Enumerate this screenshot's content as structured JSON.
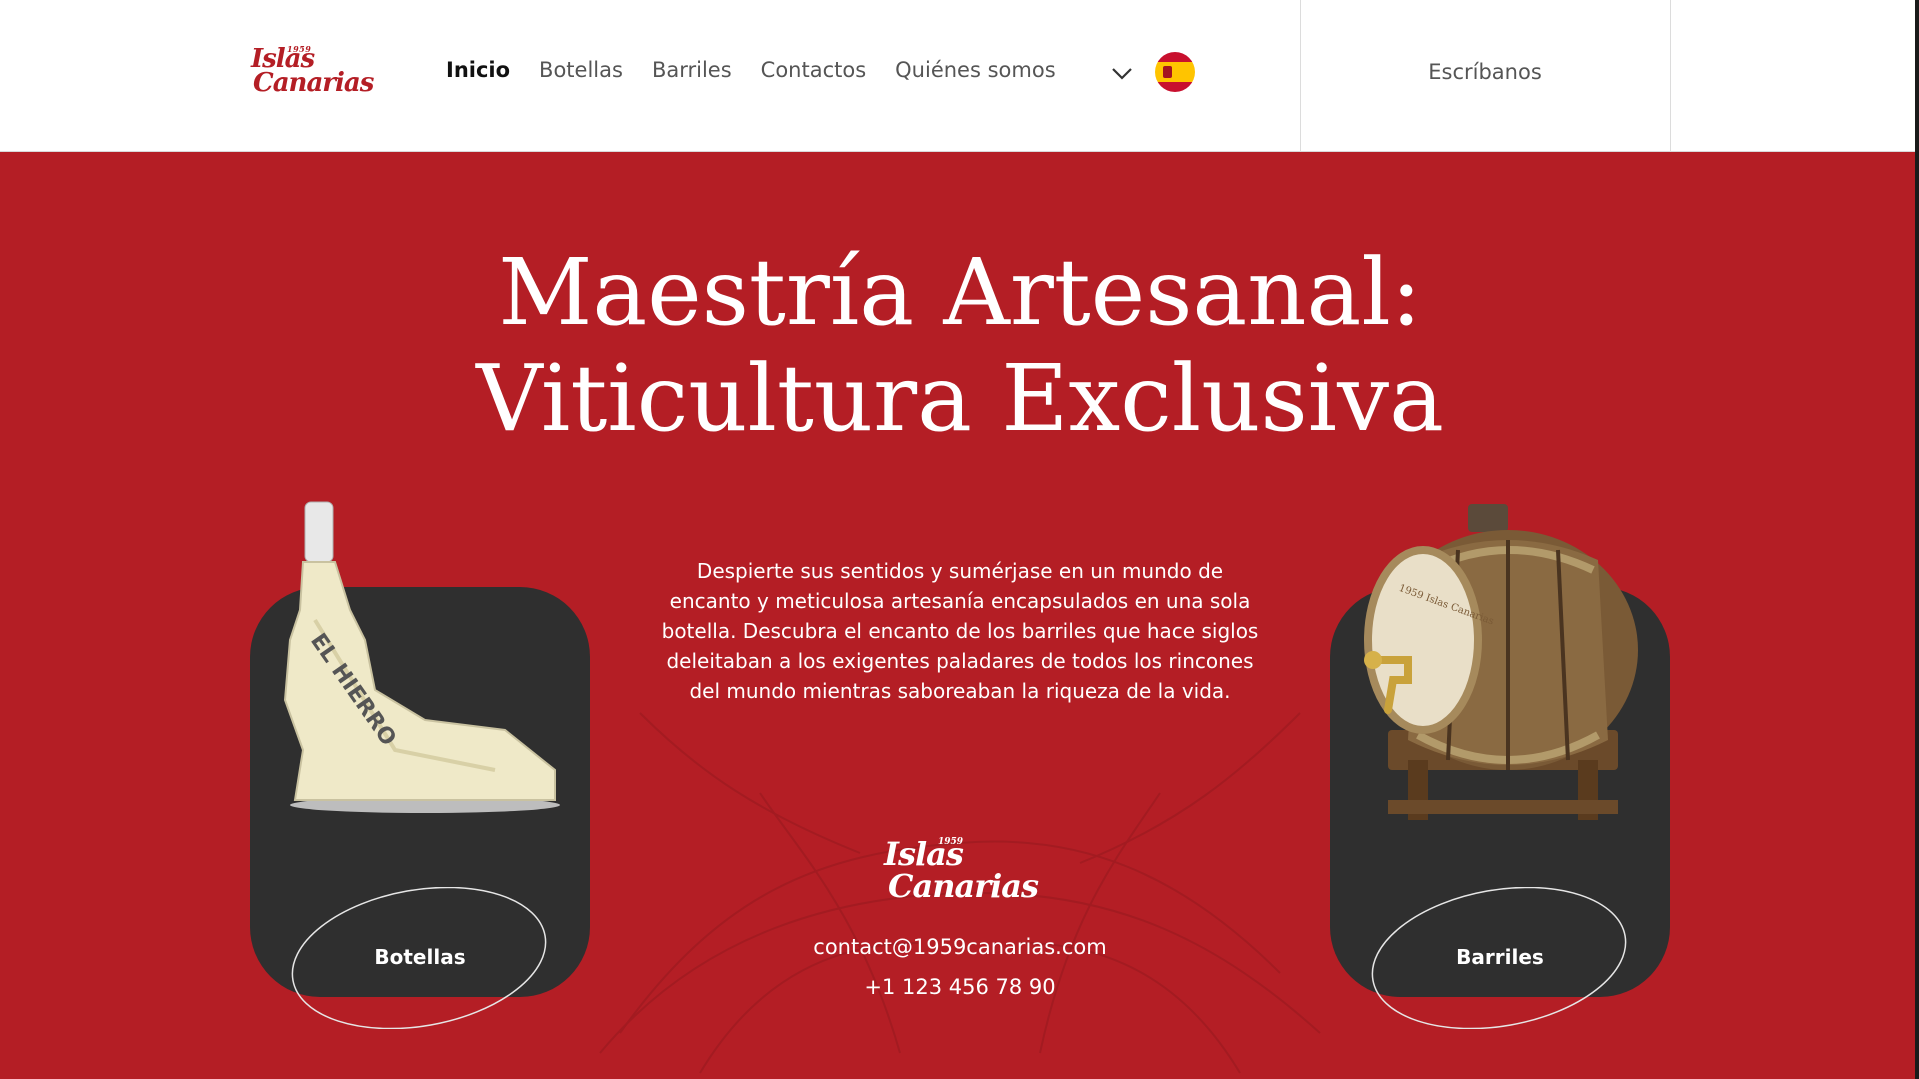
{
  "brand": {
    "year": "1959",
    "line1": "Islas",
    "line2": "Canarias"
  },
  "nav": {
    "items": [
      {
        "label": "Inicio",
        "active": true
      },
      {
        "label": "Botellas",
        "active": false
      },
      {
        "label": "Barriles",
        "active": false
      },
      {
        "label": "Contactos",
        "active": false
      },
      {
        "label": "Quiénes somos",
        "active": false
      }
    ],
    "write_label": "Escríbanos",
    "language_flag": "spain-flag-icon"
  },
  "hero": {
    "title_line1": "Maestría Artesanal:",
    "title_line2": "Viticultura Exclusiva",
    "description": "Despierte sus sentidos y sumérjase en un mundo de encanto y meticulosa artesanía encapsulados en una sola botella. Descubra el encanto de los barriles que hace siglos deleitaban a los exigentes paladares de todos los rincones del mundo mientras saboreaban la riqueza de la vida.",
    "bottle_engraving": "EL HIERRO",
    "barrel_engraving": "1959 Islas Canarias"
  },
  "cards": {
    "left_label": "Botellas",
    "right_label": "Barriles"
  },
  "contact": {
    "email": "contact@1959canarias.com",
    "phone": "+1 123 456 78 90"
  },
  "colors": {
    "accent": "#b41e25",
    "card": "#2f2f2f",
    "header_bg": "#ffffff"
  }
}
